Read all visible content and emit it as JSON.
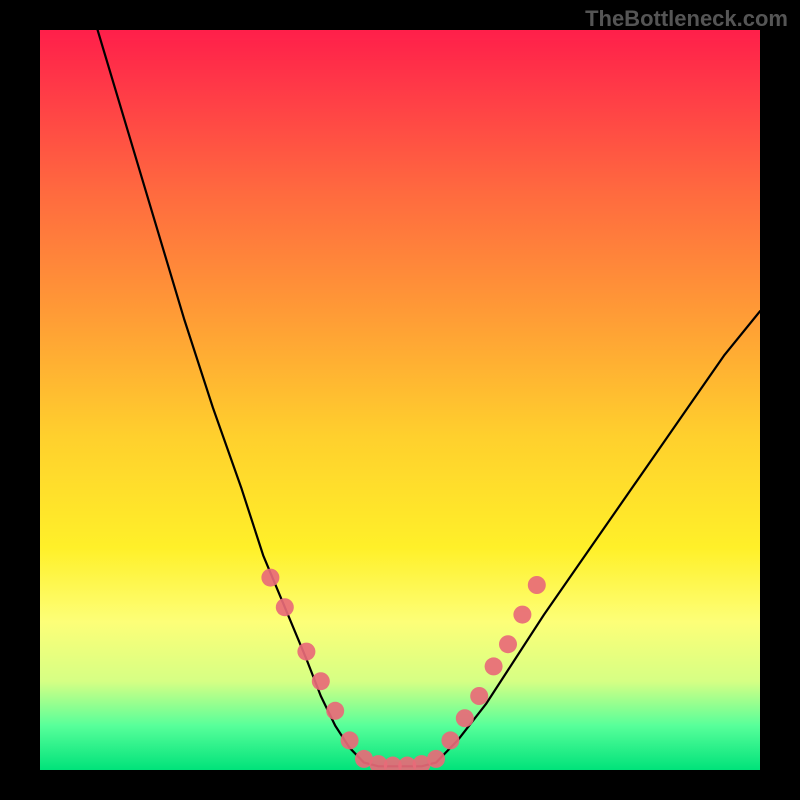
{
  "watermark": "TheBottleneck.com",
  "chart_data": {
    "type": "line",
    "title": "",
    "xlabel": "",
    "ylabel": "",
    "xlim": [
      0,
      100
    ],
    "ylim": [
      0,
      100
    ],
    "series": [
      {
        "name": "curve-left",
        "x": [
          8,
          12,
          16,
          20,
          24,
          28,
          31,
          34,
          37,
          39,
          41,
          43,
          45
        ],
        "y": [
          100,
          87,
          74,
          61,
          49,
          38,
          29,
          22,
          15,
          10,
          6,
          3,
          1
        ]
      },
      {
        "name": "flat-bottom",
        "x": [
          45,
          47,
          49,
          51,
          53,
          55
        ],
        "y": [
          1,
          0.5,
          0.5,
          0.5,
          0.5,
          1
        ]
      },
      {
        "name": "curve-right",
        "x": [
          55,
          58,
          62,
          66,
          70,
          75,
          80,
          85,
          90,
          95,
          100
        ],
        "y": [
          1,
          4,
          9,
          15,
          21,
          28,
          35,
          42,
          49,
          56,
          62
        ]
      }
    ],
    "markers": {
      "name": "dots",
      "color_hex": "#e86a78",
      "radius": 9,
      "points": [
        {
          "x": 32,
          "y": 26
        },
        {
          "x": 34,
          "y": 22
        },
        {
          "x": 37,
          "y": 16
        },
        {
          "x": 39,
          "y": 12
        },
        {
          "x": 41,
          "y": 8
        },
        {
          "x": 43,
          "y": 4
        },
        {
          "x": 45,
          "y": 1.5
        },
        {
          "x": 47,
          "y": 0.8
        },
        {
          "x": 49,
          "y": 0.6
        },
        {
          "x": 51,
          "y": 0.6
        },
        {
          "x": 53,
          "y": 0.8
        },
        {
          "x": 55,
          "y": 1.5
        },
        {
          "x": 57,
          "y": 4
        },
        {
          "x": 59,
          "y": 7
        },
        {
          "x": 61,
          "y": 10
        },
        {
          "x": 63,
          "y": 14
        },
        {
          "x": 65,
          "y": 17
        },
        {
          "x": 67,
          "y": 21
        },
        {
          "x": 69,
          "y": 25
        }
      ]
    },
    "gradient_colors": {
      "top": "#ff1f4a",
      "mid_upper": "#ff9a36",
      "mid": "#fff029",
      "mid_lower": "#d6ff84",
      "bottom": "#00e27a"
    }
  }
}
